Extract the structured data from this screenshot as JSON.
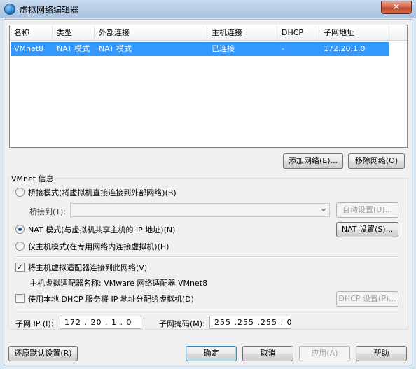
{
  "window": {
    "title": "虚拟网络编辑器",
    "close_label": "✕"
  },
  "list": {
    "columns": [
      "名称",
      "类型",
      "外部连接",
      "主机连接",
      "DHCP",
      "子网地址"
    ],
    "rows": [
      {
        "name": "VMnet8",
        "type": "NAT 模式",
        "external": "NAT 模式",
        "host": "已连接",
        "dhcp": "-",
        "subnet": "172.20.1.0"
      }
    ]
  },
  "list_buttons": {
    "add": "添加网络(E)...",
    "remove": "移除网络(O)"
  },
  "vmnet_info": {
    "group_label": "VMnet 信息",
    "bridged_label": "桥接模式(将虚拟机直接连接到外部网络)(B)",
    "bridged_to_label": "桥接到(T):",
    "bridged_to_value": "",
    "auto_settings": "自动设置(U)...",
    "nat_label": "NAT 模式(与虚拟机共享主机的 IP 地址)(N)",
    "nat_settings": "NAT 设置(S)...",
    "hostonly_label": "仅主机模式(在专用网络内连接虚拟机)(H)",
    "selected_mode": "nat",
    "connect_adapter_label": "将主机虚拟适配器连接到此网络(V)",
    "connect_adapter_checked": true,
    "adapter_name_label": "主机虚拟适配器名称: VMware 网络适配器 VMnet8",
    "use_dhcp_label": "使用本地 DHCP 服务将 IP 地址分配给虚拟机(D)",
    "use_dhcp_checked": false,
    "dhcp_settings": "DHCP 设置(P)...",
    "subnet_ip_label": "子网 IP (I):",
    "subnet_ip": "172 . 20 . 1 . 0",
    "subnet_mask_label": "子网掩码(M):",
    "subnet_mask": "255 .255 .255 . 0"
  },
  "footer": {
    "restore": "还原默认设置(R)",
    "ok": "确定",
    "cancel": "取消",
    "apply": "应用(A)",
    "help": "帮助"
  },
  "colors": {
    "selection": "#3399ff",
    "window_frame": "#dbe6f3"
  }
}
